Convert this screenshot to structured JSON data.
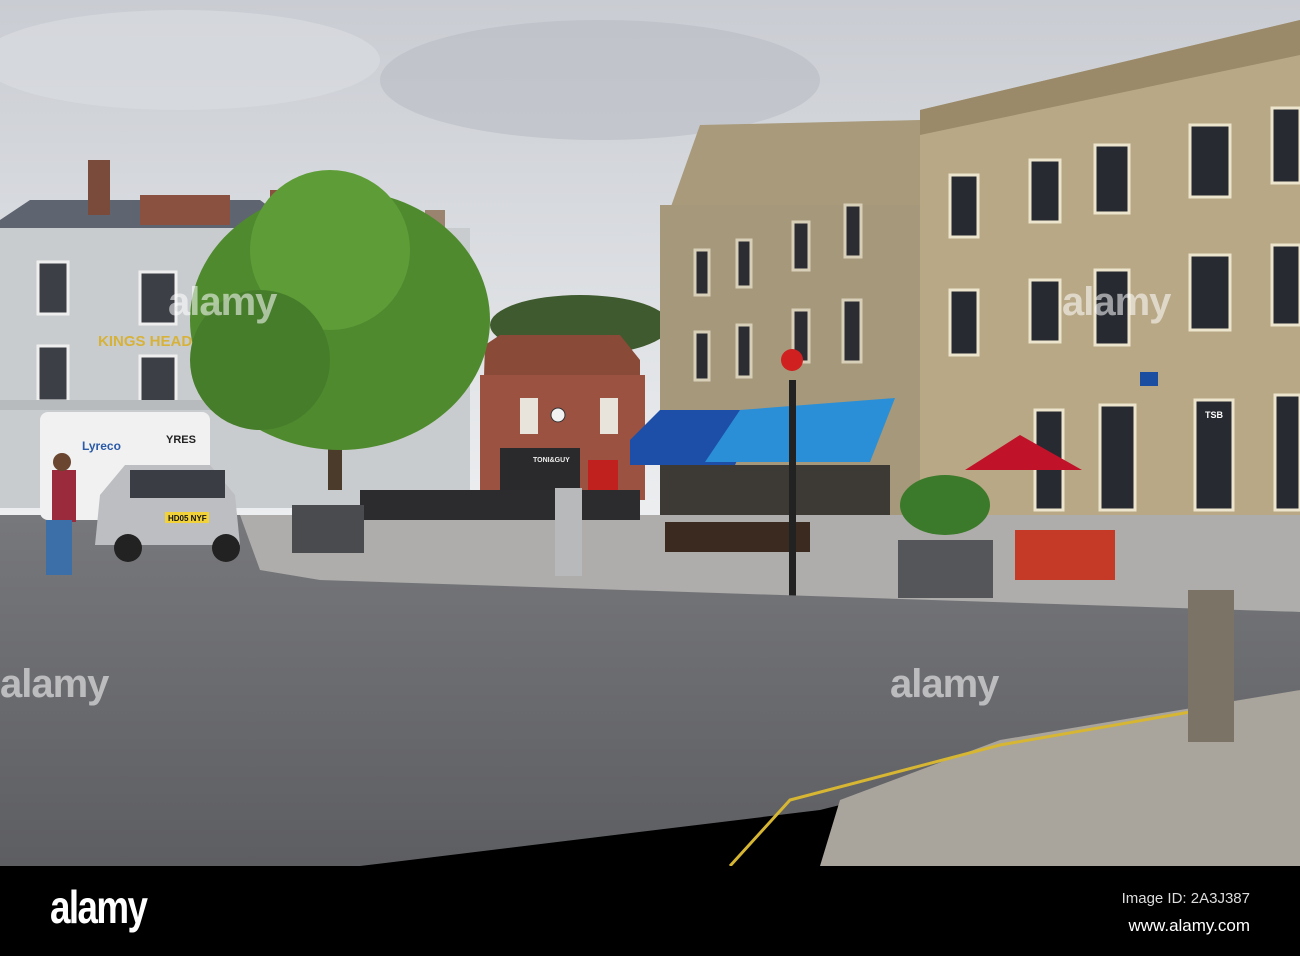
{
  "photo": {
    "signs": {
      "pub_name": "KINGS HEAD",
      "van_brand": "Lyreco",
      "tyres": "YRES",
      "plate": "HD05 NYF",
      "salon": "TONI&GUY",
      "bank": "TSB"
    },
    "watermark": "alamy"
  },
  "footer": {
    "logo": "alamy",
    "image_id": "Image ID: 2A3J387",
    "url": "www.alamy.com"
  }
}
